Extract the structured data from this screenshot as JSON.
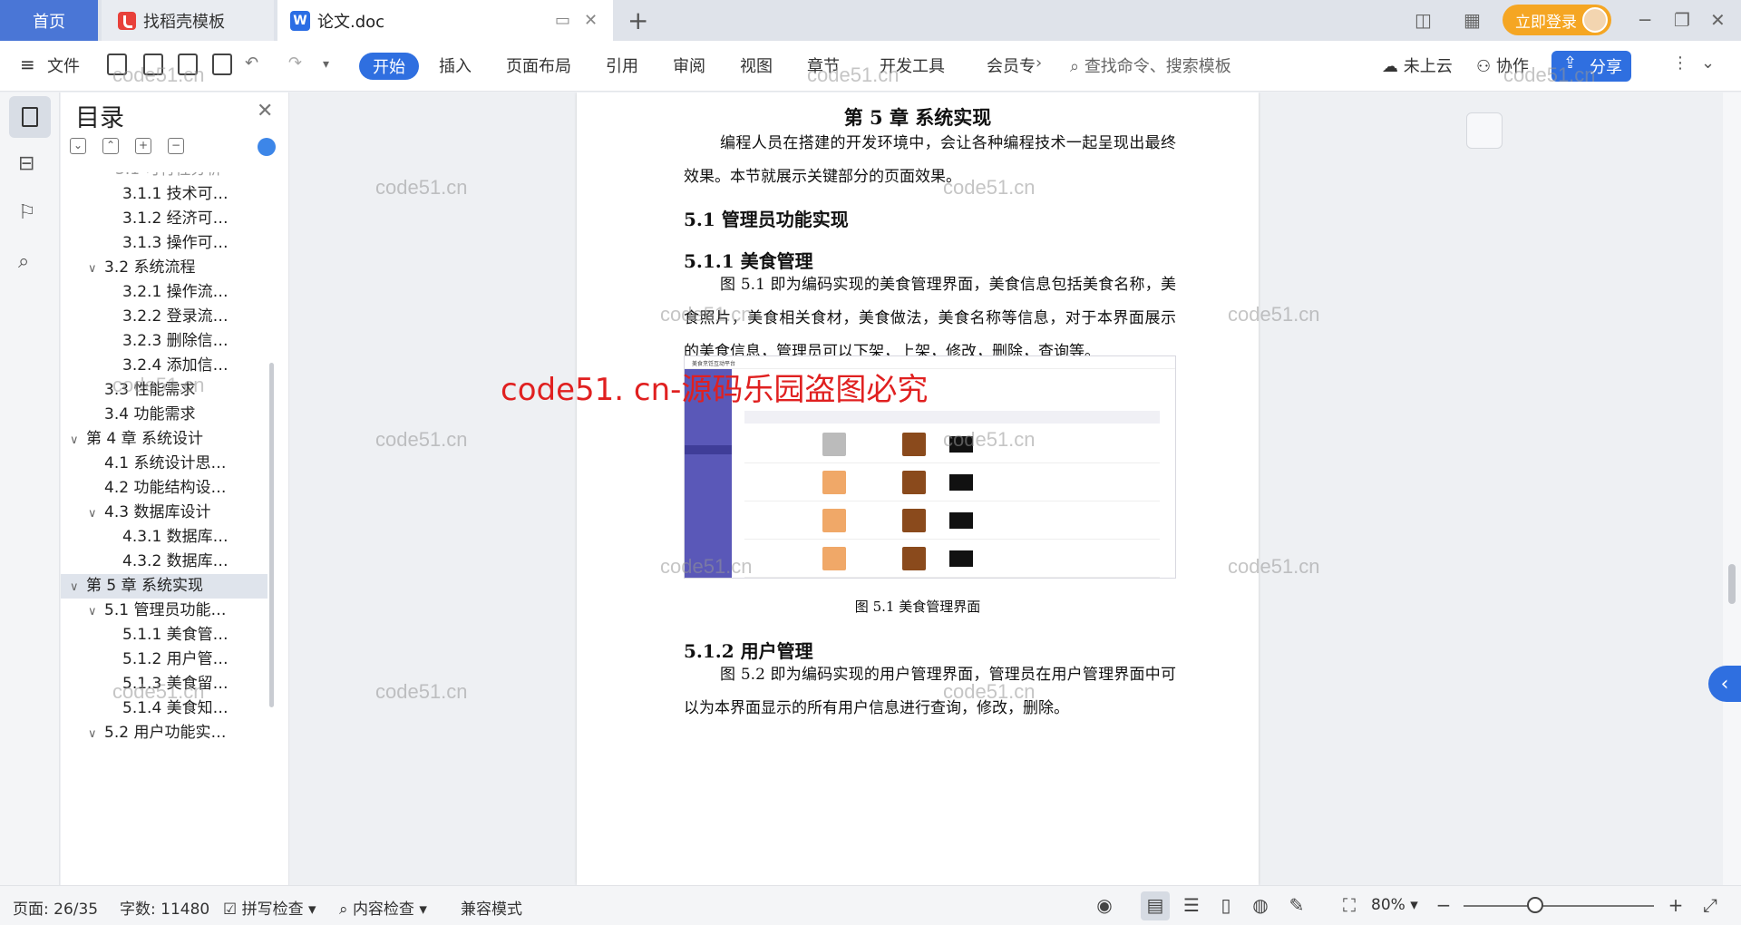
{
  "tabs": {
    "home": "首页",
    "templates": "找稻壳模板",
    "doc": "论文.doc"
  },
  "titlebar": {
    "login": "立即登录"
  },
  "toolbar": {
    "file": "文件",
    "start": "开始",
    "insert": "插入",
    "layout": "页面布局",
    "reference": "引用",
    "review": "审阅",
    "view": "视图",
    "chapter": "章节",
    "devtools": "开发工具",
    "member": "会员专",
    "search": "查找命令、搜索模板",
    "cloud": "未上云",
    "collab": "协作",
    "share": "分享"
  },
  "toc": {
    "title": "目录",
    "items": [
      {
        "label": "3.1.1  技术可…"
      },
      {
        "label": "3.1.2  经济可…"
      },
      {
        "label": "3.1.3  操作可…"
      },
      {
        "label": "3.2  系统流程"
      },
      {
        "label": "3.2.1  操作流…"
      },
      {
        "label": "3.2.2  登录流…"
      },
      {
        "label": "3.2.3  删除信…"
      },
      {
        "label": "3.2.4  添加信…"
      },
      {
        "label": "3.3  性能需求"
      },
      {
        "label": "3.4  功能需求"
      },
      {
        "label": "第 4 章  系统设计"
      },
      {
        "label": "4.1  系统设计思…"
      },
      {
        "label": "4.2  功能结构设…"
      },
      {
        "label": "4.3  数据库设计"
      },
      {
        "label": "4.3.1  数据库…"
      },
      {
        "label": "4.3.2  数据库…"
      },
      {
        "label": "第 5 章  系统实现"
      },
      {
        "label": "5.1  管理员功能…"
      },
      {
        "label": "5.1.1  美食管…"
      },
      {
        "label": "5.1.2  用户管…"
      },
      {
        "label": "5.1.3  美食留…"
      },
      {
        "label": "5.1.4  美食知…"
      },
      {
        "label": "5.2  用户功能实…"
      }
    ]
  },
  "doc": {
    "chapter": "第 5 章  系统实现",
    "p1": "编程人员在搭建的开发环境中，会让各种编程技术一起呈现出最终效果。本节就展示关键部分的页面效果。",
    "h_5_1": "5.1  管理员功能实现",
    "h_5_1_1": "5.1.1  美食管理",
    "p2": "图 5.1 即为编码实现的美食管理界面，美食信息包括美食名称，美食照片，美食相关食材，美食做法，美食名称等信息，对于本界面展示的美食信息，管理员可以下架，上架，修改，删除，查询等。",
    "fig_caption": "图 5.1  美食管理界面",
    "fig_title": "美食烹饪互动平台",
    "h_5_1_2": "5.1.2  用户管理",
    "p3": "图 5.2 即为编码实现的用户管理界面，管理员在用户管理界面中可以为本界面显示的所有用户信息进行查询，修改，删除。"
  },
  "watermark": {
    "small": "code51.cn",
    "big": "code51. cn-源码乐园盗图必究"
  },
  "status": {
    "page": "页面: 26/35",
    "words": "字数: 11480",
    "spell": "拼写检查",
    "content": "内容检查",
    "compat": "兼容模式",
    "zoom": "80%"
  }
}
